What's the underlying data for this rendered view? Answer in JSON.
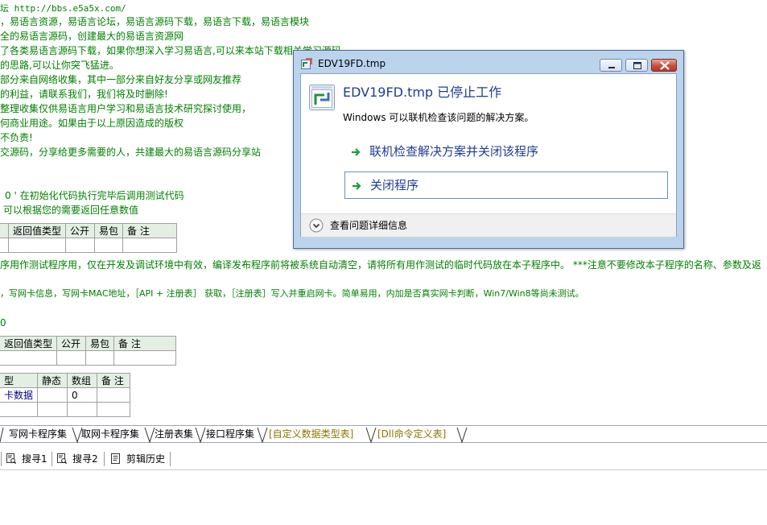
{
  "editor": {
    "lines": [
      "坛 http://bbs.e5a5x.com/",
      "，易语言资源，易语言论坛，易语言源码下载，易语言下载，易语言模块",
      "全的易语言源码，创建最大的易语言资源网",
      "了各类易语言源码下载，如果你想深入学习易语言,可以来本站下载相关学习源码",
      "的思路,可以让你突飞猛进。",
      "部分来自网络收集，其中一部分来自好友分享或网友推荐",
      "的利益，请联系我们，我们将及时删除!",
      "整理收集仅供易语言用户学习和易语言技术研究探讨使用，",
      "何商业用途。如果由于以上原因造成的版权",
      "不负责!",
      "交源码，分享给更多需要的人，共建最大的易语言源码分享站",
      "0 ' 在初始化代码执行完毕后调用测试代码",
      "可以根据您的需要返回任意数值",
      "序用作测试程序用，仅在开发及调试环境中有效，编译发布程序前将被系统自动清空，请将所有用作测试的临时代码放在本子程序中。 ***注意不要修改本子程序的名称、参数及返",
      "，写网卡信息，写网卡MAC地址，［API + 注册表］ 获取，［注册表］写入并重启网卡。简单易用，内加是否真实网卡判断，Win7/Win8等尚未测试。",
      "0"
    ],
    "table1": {
      "headers": [
        "",
        "返回值类型",
        "公开",
        "易包",
        "备 注"
      ]
    },
    "table2": {
      "headers": [
        "返回值类型",
        "公开",
        "易包",
        "备 注"
      ]
    },
    "table3": {
      "headers": [
        "型",
        "静态",
        "数组",
        "备 注"
      ],
      "row": [
        "卡数据",
        "",
        "0",
        ""
      ]
    }
  },
  "tabs": [
    {
      "label": "写网卡程序集",
      "custom": false
    },
    {
      "label": "取网卡程序集",
      "custom": false
    },
    {
      "label": "注册表集",
      "custom": false
    },
    {
      "label": "接口程序集",
      "custom": false
    },
    {
      "label": "[自定义数据类型表]",
      "custom": true
    },
    {
      "label": "[Dll命令定义表]",
      "custom": true
    }
  ],
  "toolbar": {
    "search1": "搜寻1",
    "search2": "搜寻2",
    "clip_history": "剪辑历史"
  },
  "dialog": {
    "title": "EDV19FD.tmp",
    "headline": "EDV19FD.tmp 已停止工作",
    "subtext": "Windows 可以联机检查该问题的解决方案。",
    "option1": "联机检查解决方案并关闭该程序",
    "option2": "关闭程序",
    "details": "查看问题详细信息",
    "colors": {
      "headline": "#1f3d91",
      "arrow": "#1e9b3a",
      "frame": "#bcd3ec"
    }
  }
}
